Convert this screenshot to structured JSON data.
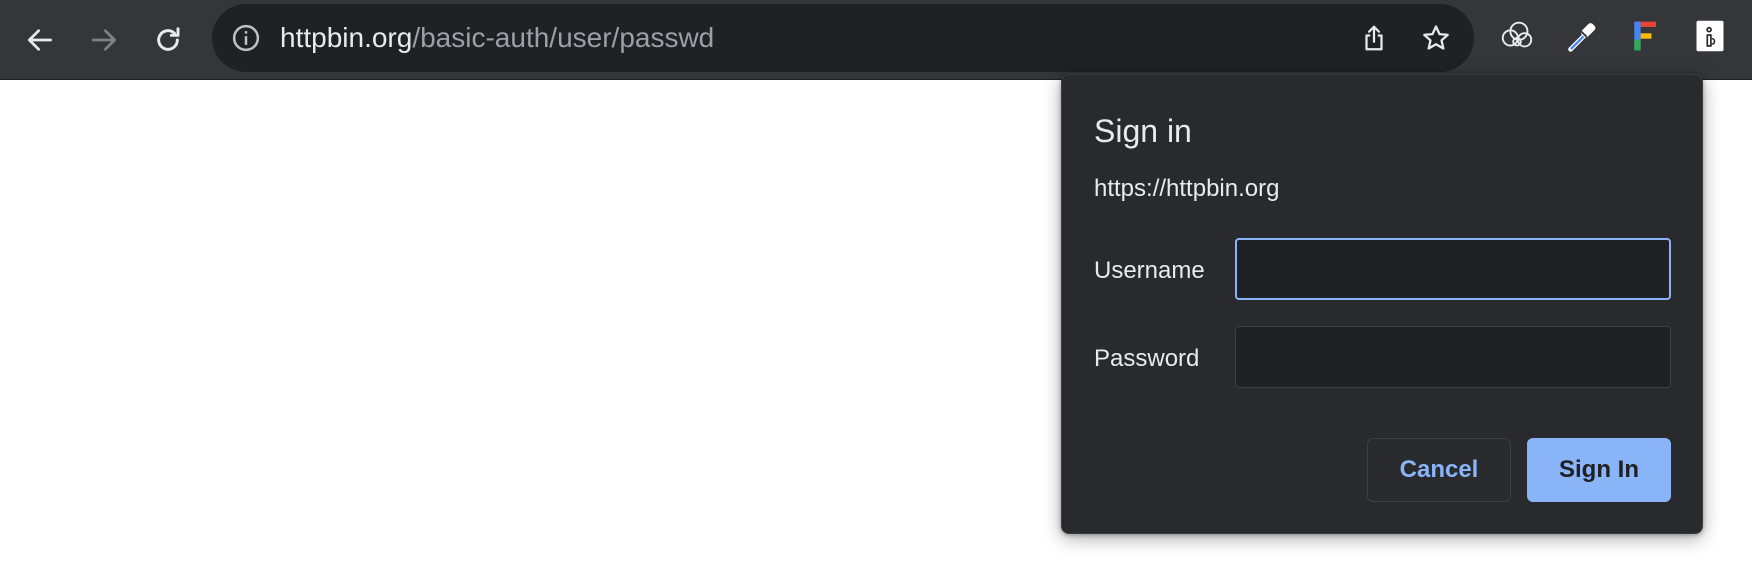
{
  "browser": {
    "url_host": "httpbin.org",
    "url_path": "/basic-auth/user/passwd",
    "icons": {
      "back": "arrow-left-icon",
      "forward": "arrow-right-icon",
      "reload": "reload-icon",
      "site_info": "info-icon",
      "share": "share-icon",
      "bookmark": "star-icon"
    },
    "extensions": [
      "cloud-extension-icon",
      "eyedropper-extension-icon",
      "colored-f-extension-icon",
      "info-box-extension-icon"
    ]
  },
  "dialog": {
    "title": "Sign in",
    "origin": "https://httpbin.org",
    "username_label": "Username",
    "username_value": "",
    "password_label": "Password",
    "password_value": "",
    "cancel_label": "Cancel",
    "signin_label": "Sign In",
    "accent_color": "#8ab4f8"
  }
}
